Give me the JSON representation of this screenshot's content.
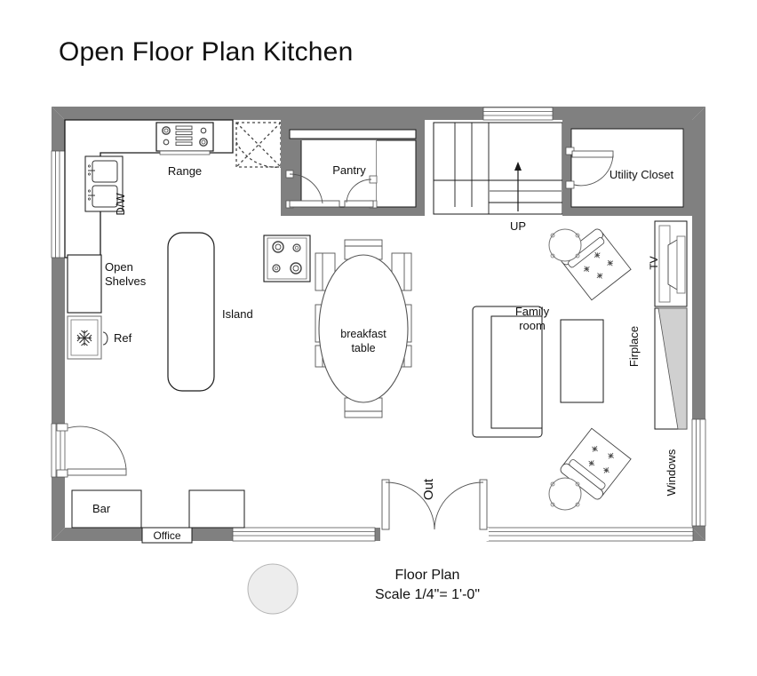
{
  "page": {
    "title": "Open Floor Plan Kitchen",
    "background": "#ffffff"
  },
  "caption": {
    "line1": "Floor Plan",
    "line2": "Scale 1/4\"= 1'-0\"",
    "swatch_color": "#ededed"
  },
  "colors": {
    "wall": "#808080",
    "wall_light": "#9a9a9a",
    "outline": "#1a1a1a",
    "thin_line": "#555555",
    "hearth": "#d0d0d0",
    "white": "#ffffff"
  },
  "plan": {
    "labels": {
      "range": "Range",
      "dishwasher": "D/W",
      "open_shelves_line1": "Open",
      "open_shelves_line2": "Shelves",
      "refrigerator": "Ref",
      "island": "Island",
      "pantry": "Pantry",
      "stairs_up": "UP",
      "utility_closet": "Utility Closet",
      "breakfast_table_line1": "breakfast",
      "breakfast_table_line2": "table",
      "family_room_line1": "Family",
      "family_room_line2": "room",
      "fireplace": "Firplace",
      "television": "TV",
      "windows": "Windows",
      "bar": "Bar",
      "office": "Office",
      "exit": "Out"
    },
    "rooms": [
      {
        "name": "Pantry",
        "label": "Pantry"
      },
      {
        "name": "Utility Closet",
        "label": "Utility Closet"
      },
      {
        "name": "Family room",
        "label": "Family room"
      }
    ],
    "fixtures": [
      {
        "name": "range",
        "label": "Range",
        "burners": 4
      },
      {
        "name": "dishwasher",
        "label": "D/W"
      },
      {
        "name": "double-sink",
        "label": ""
      },
      {
        "name": "open-shelves",
        "label": "Open Shelves"
      },
      {
        "name": "refrigerator",
        "label": "Ref"
      },
      {
        "name": "island",
        "label": "Island"
      },
      {
        "name": "cooktop",
        "label": "",
        "burners": 4
      },
      {
        "name": "breakfast-table",
        "label": "breakfast table",
        "chairs": 6
      },
      {
        "name": "sofa",
        "label": ""
      },
      {
        "name": "coffee-table",
        "label": ""
      },
      {
        "name": "armchair-upper",
        "label": ""
      },
      {
        "name": "armchair-lower",
        "label": ""
      },
      {
        "name": "side-table-upper",
        "label": ""
      },
      {
        "name": "side-table-lower",
        "label": ""
      },
      {
        "name": "fireplace",
        "label": "Firplace"
      },
      {
        "name": "television",
        "label": "TV"
      },
      {
        "name": "bar",
        "label": "Bar"
      },
      {
        "name": "office-desk",
        "label": "Office"
      },
      {
        "name": "stairs",
        "label": "UP",
        "direction": "up"
      },
      {
        "name": "exit-double-door",
        "label": "Out"
      },
      {
        "name": "window-band-left",
        "label": ""
      },
      {
        "name": "window-band-top-right",
        "label": ""
      },
      {
        "name": "window-band-right",
        "label": "Windows"
      },
      {
        "name": "window-band-bottom-left",
        "label": ""
      },
      {
        "name": "window-band-bottom-right",
        "label": ""
      }
    ]
  }
}
